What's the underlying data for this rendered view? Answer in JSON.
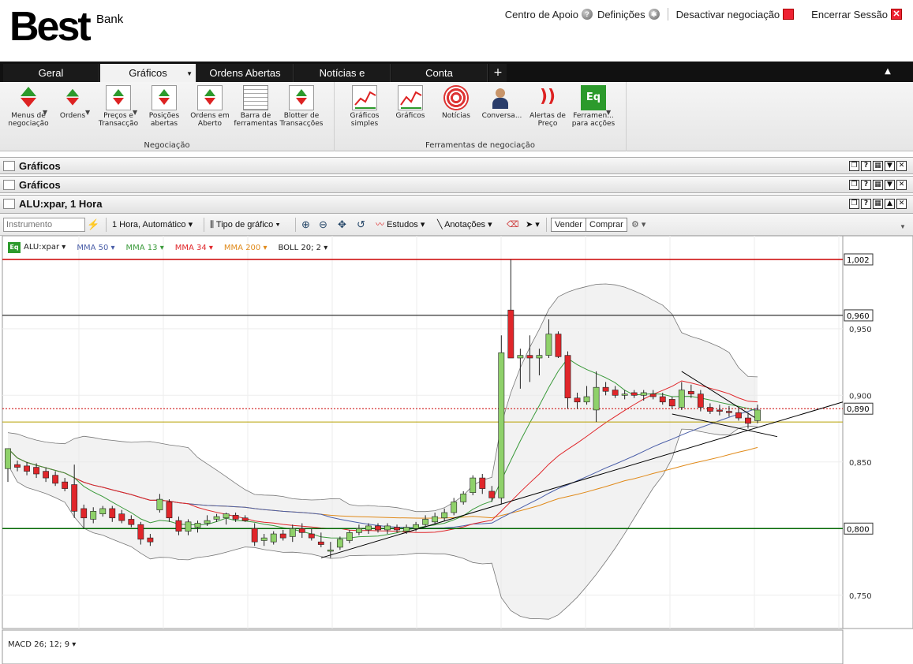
{
  "header": {
    "logo_main": "Best",
    "logo_sub": "Bank",
    "links": {
      "support": "Centro de Apoio",
      "settings": "Definições",
      "disable_trading": "Desactivar negociação",
      "logout": "Encerrar Sessão"
    }
  },
  "tabs": [
    {
      "label": "Geral"
    },
    {
      "label": "Gráficos"
    },
    {
      "label": "Ordens Abertas"
    },
    {
      "label": "Notícias e"
    },
    {
      "label": "Conta"
    }
  ],
  "tab_plus": "+",
  "ribbon": {
    "group1_label": "Negociação",
    "group2_label": "Ferramentas de negociação",
    "group1": [
      {
        "label": "Menus de\nnegociação"
      },
      {
        "label": "Ordens"
      },
      {
        "label": "Preços e\nTransacção"
      },
      {
        "label": "Posições\nabertas"
      },
      {
        "label": "Ordens em\nAberto"
      },
      {
        "label": "Barra de\nferramentas"
      },
      {
        "label": "Blotter de\nTransacções"
      }
    ],
    "group2": [
      {
        "label": "Gráficos\nsimples"
      },
      {
        "label": "Gráficos"
      },
      {
        "label": "Notícias"
      },
      {
        "label": "Conversa..."
      },
      {
        "label": "Alertas de\nPreço"
      },
      {
        "label": "Ferramen...\npara acções"
      }
    ]
  },
  "panels": {
    "p1": "Gráficos",
    "p2": "Gráficos",
    "p3": "ALU:xpar, 1 Hora"
  },
  "toolbar": {
    "instrument_placeholder": "Instrumento",
    "timeframe": "1 Hora,  Automático",
    "chart_type": "Tipo de gráfico",
    "studies": "Estudos",
    "annotations": "Anotações",
    "sell": "Vender",
    "buy": "Comprar"
  },
  "legend": {
    "instrument": "ALU:xpar",
    "ma50": "MMA 50",
    "ma13": "MMA 13",
    "ma34": "MMA 34",
    "ma200": "MMA 200",
    "boll": "BOLL 20; 2",
    "macd": "MACD 26; 12; 9"
  },
  "colors": {
    "up": "#8fd16a",
    "down": "#e0262a",
    "ma50": "#4a5ea8",
    "ma13": "#3a9a3a",
    "ma34": "#e0262a",
    "ma200": "#e08a1a"
  },
  "chart_data": {
    "type": "line",
    "title": "ALU:xpar, 1 Hora",
    "ylim": [
      0.725,
      1.015
    ],
    "y_ticks": [
      "0,950",
      "0,900",
      "0,850",
      "0,800",
      "0,750"
    ],
    "price_labels": [
      "1,002",
      "0,960",
      "0,890",
      "0,800"
    ],
    "horizontal_levels": [
      1.002,
      0.96,
      0.89,
      0.8,
      0.88
    ],
    "candles": [
      {
        "o": 0.845,
        "h": 0.86,
        "l": 0.835,
        "c": 0.86
      },
      {
        "o": 0.848,
        "h": 0.851,
        "l": 0.843,
        "c": 0.846
      },
      {
        "o": 0.847,
        "h": 0.85,
        "l": 0.84,
        "c": 0.843
      },
      {
        "o": 0.846,
        "h": 0.849,
        "l": 0.838,
        "c": 0.841
      },
      {
        "o": 0.843,
        "h": 0.846,
        "l": 0.835,
        "c": 0.838
      },
      {
        "o": 0.84,
        "h": 0.843,
        "l": 0.832,
        "c": 0.834
      },
      {
        "o": 0.835,
        "h": 0.838,
        "l": 0.828,
        "c": 0.83
      },
      {
        "o": 0.833,
        "h": 0.848,
        "l": 0.808,
        "c": 0.813
      },
      {
        "o": 0.815,
        "h": 0.818,
        "l": 0.8,
        "c": 0.808
      },
      {
        "o": 0.807,
        "h": 0.816,
        "l": 0.804,
        "c": 0.813
      },
      {
        "o": 0.811,
        "h": 0.817,
        "l": 0.809,
        "c": 0.815
      },
      {
        "o": 0.815,
        "h": 0.817,
        "l": 0.805,
        "c": 0.808
      },
      {
        "o": 0.811,
        "h": 0.814,
        "l": 0.804,
        "c": 0.806
      },
      {
        "o": 0.807,
        "h": 0.81,
        "l": 0.801,
        "c": 0.803
      },
      {
        "o": 0.803,
        "h": 0.805,
        "l": 0.788,
        "c": 0.792
      },
      {
        "o": 0.793,
        "h": 0.796,
        "l": 0.787,
        "c": 0.79
      },
      {
        "o": 0.814,
        "h": 0.826,
        "l": 0.812,
        "c": 0.822
      },
      {
        "o": 0.82,
        "h": 0.822,
        "l": 0.805,
        "c": 0.808
      },
      {
        "o": 0.806,
        "h": 0.809,
        "l": 0.795,
        "c": 0.798
      },
      {
        "o": 0.798,
        "h": 0.807,
        "l": 0.795,
        "c": 0.805
      },
      {
        "o": 0.801,
        "h": 0.806,
        "l": 0.797,
        "c": 0.804
      },
      {
        "o": 0.804,
        "h": 0.81,
        "l": 0.802,
        "c": 0.806
      },
      {
        "o": 0.807,
        "h": 0.811,
        "l": 0.805,
        "c": 0.809
      },
      {
        "o": 0.808,
        "h": 0.812,
        "l": 0.803,
        "c": 0.811
      },
      {
        "o": 0.81,
        "h": 0.812,
        "l": 0.805,
        "c": 0.807
      },
      {
        "o": 0.808,
        "h": 0.81,
        "l": 0.805,
        "c": 0.806
      },
      {
        "o": 0.8,
        "h": 0.804,
        "l": 0.787,
        "c": 0.79
      },
      {
        "o": 0.791,
        "h": 0.796,
        "l": 0.787,
        "c": 0.793
      },
      {
        "o": 0.79,
        "h": 0.798,
        "l": 0.788,
        "c": 0.796
      },
      {
        "o": 0.796,
        "h": 0.799,
        "l": 0.791,
        "c": 0.793
      },
      {
        "o": 0.794,
        "h": 0.803,
        "l": 0.79,
        "c": 0.8
      },
      {
        "o": 0.8,
        "h": 0.804,
        "l": 0.793,
        "c": 0.797
      },
      {
        "o": 0.796,
        "h": 0.8,
        "l": 0.791,
        "c": 0.793
      },
      {
        "o": 0.79,
        "h": 0.797,
        "l": 0.786,
        "c": 0.788
      },
      {
        "o": 0.783,
        "h": 0.79,
        "l": 0.778,
        "c": 0.784
      },
      {
        "o": 0.786,
        "h": 0.794,
        "l": 0.784,
        "c": 0.792
      },
      {
        "o": 0.791,
        "h": 0.799,
        "l": 0.789,
        "c": 0.797
      },
      {
        "o": 0.797,
        "h": 0.803,
        "l": 0.795,
        "c": 0.8
      },
      {
        "o": 0.799,
        "h": 0.804,
        "l": 0.796,
        "c": 0.802
      },
      {
        "o": 0.802,
        "h": 0.804,
        "l": 0.797,
        "c": 0.799
      },
      {
        "o": 0.799,
        "h": 0.804,
        "l": 0.796,
        "c": 0.802
      },
      {
        "o": 0.801,
        "h": 0.803,
        "l": 0.797,
        "c": 0.799
      },
      {
        "o": 0.798,
        "h": 0.803,
        "l": 0.796,
        "c": 0.801
      },
      {
        "o": 0.8,
        "h": 0.805,
        "l": 0.798,
        "c": 0.803
      },
      {
        "o": 0.803,
        "h": 0.81,
        "l": 0.801,
        "c": 0.807
      },
      {
        "o": 0.805,
        "h": 0.812,
        "l": 0.803,
        "c": 0.809
      },
      {
        "o": 0.808,
        "h": 0.815,
        "l": 0.806,
        "c": 0.812
      },
      {
        "o": 0.812,
        "h": 0.823,
        "l": 0.81,
        "c": 0.82
      },
      {
        "o": 0.82,
        "h": 0.828,
        "l": 0.818,
        "c": 0.826
      },
      {
        "o": 0.827,
        "h": 0.84,
        "l": 0.825,
        "c": 0.838
      },
      {
        "o": 0.838,
        "h": 0.841,
        "l": 0.826,
        "c": 0.83
      },
      {
        "o": 0.828,
        "h": 0.832,
        "l": 0.82,
        "c": 0.823
      },
      {
        "o": 0.823,
        "h": 0.945,
        "l": 0.818,
        "c": 0.932
      },
      {
        "o": 0.964,
        "h": 1.002,
        "l": 0.928,
        "c": 0.928
      },
      {
        "o": 0.928,
        "h": 0.935,
        "l": 0.905,
        "c": 0.93
      },
      {
        "o": 0.93,
        "h": 0.945,
        "l": 0.91,
        "c": 0.928
      },
      {
        "o": 0.928,
        "h": 0.935,
        "l": 0.915,
        "c": 0.93
      },
      {
        "o": 0.93,
        "h": 0.957,
        "l": 0.928,
        "c": 0.946
      },
      {
        "o": 0.946,
        "h": 0.948,
        "l": 0.928,
        "c": 0.929
      },
      {
        "o": 0.93,
        "h": 0.933,
        "l": 0.89,
        "c": 0.898
      },
      {
        "o": 0.898,
        "h": 0.902,
        "l": 0.89,
        "c": 0.895
      },
      {
        "o": 0.895,
        "h": 0.907,
        "l": 0.893,
        "c": 0.899
      },
      {
        "o": 0.889,
        "h": 0.918,
        "l": 0.88,
        "c": 0.906
      },
      {
        "o": 0.906,
        "h": 0.91,
        "l": 0.9,
        "c": 0.903
      },
      {
        "o": 0.904,
        "h": 0.907,
        "l": 0.898,
        "c": 0.9
      },
      {
        "o": 0.9,
        "h": 0.904,
        "l": 0.897,
        "c": 0.901
      },
      {
        "o": 0.902,
        "h": 0.904,
        "l": 0.898,
        "c": 0.9
      },
      {
        "o": 0.9,
        "h": 0.904,
        "l": 0.896,
        "c": 0.902
      },
      {
        "o": 0.901,
        "h": 0.904,
        "l": 0.897,
        "c": 0.899
      },
      {
        "o": 0.899,
        "h": 0.902,
        "l": 0.893,
        "c": 0.895
      },
      {
        "o": 0.897,
        "h": 0.899,
        "l": 0.89,
        "c": 0.892
      },
      {
        "o": 0.891,
        "h": 0.91,
        "l": 0.889,
        "c": 0.904
      },
      {
        "o": 0.903,
        "h": 0.908,
        "l": 0.898,
        "c": 0.901
      },
      {
        "o": 0.901,
        "h": 0.904,
        "l": 0.888,
        "c": 0.891
      },
      {
        "o": 0.891,
        "h": 0.894,
        "l": 0.886,
        "c": 0.888
      },
      {
        "o": 0.889,
        "h": 0.893,
        "l": 0.885,
        "c": 0.888
      },
      {
        "o": 0.888,
        "h": 0.892,
        "l": 0.884,
        "c": 0.887
      },
      {
        "o": 0.887,
        "h": 0.89,
        "l": 0.881,
        "c": 0.883
      },
      {
        "o": 0.883,
        "h": 0.887,
        "l": 0.875,
        "c": 0.879
      },
      {
        "o": 0.881,
        "h": 0.893,
        "l": 0.879,
        "c": 0.889
      }
    ]
  }
}
